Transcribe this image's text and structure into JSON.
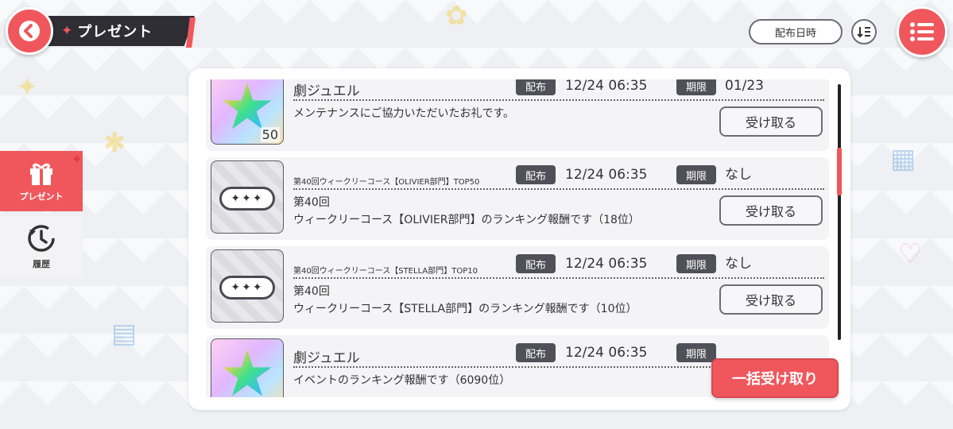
{
  "header": {
    "title": "プレゼント",
    "sort_label": "配布日時"
  },
  "sidebar": {
    "items": [
      {
        "label": "プレゼント",
        "icon": "gift-icon",
        "active": true
      },
      {
        "label": "履歴",
        "icon": "history-icon",
        "active": false
      }
    ]
  },
  "labels": {
    "distribution": "配布",
    "expiry": "期限",
    "receive": "受け取る",
    "bulk_receive": "一括受け取り"
  },
  "items": [
    {
      "name": "劇ジュエル",
      "icon": "jewel-star-icon",
      "quantity": "50",
      "distributed": "12/24 06:35",
      "expiry": "01/23",
      "description": "メンテナンスにご協力いただいたお礼です。"
    },
    {
      "name": "第40回ウィークリーコース【OLIVIER部門】TOP50",
      "icon": "ranking-badge-icon",
      "distributed": "12/24 06:35",
      "expiry": "なし",
      "description": "第40回\nウィークリーコース【OLIVIER部門】のランキング報酬です（18位）"
    },
    {
      "name": "第40回ウィークリーコース【STELLA部門】TOP10",
      "icon": "ranking-badge-icon",
      "distributed": "12/24 06:35",
      "expiry": "なし",
      "description": "第40回\nウィークリーコース【STELLA部門】のランキング報酬です（10位）"
    },
    {
      "name": "劇ジュエル",
      "icon": "jewel-star-icon",
      "distributed": "12/24 06:35",
      "expiry": "",
      "description": "イベントのランキング報酬です（6090位）"
    }
  ],
  "badge_text": "✦✦✦",
  "colors": {
    "accent": "#f0575c",
    "dark": "#2e2e34",
    "tag": "#505058"
  }
}
